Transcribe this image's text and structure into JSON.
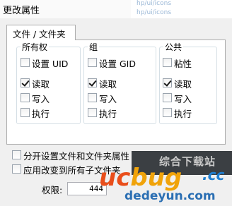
{
  "window": {
    "title": "更改属性"
  },
  "background_ghost": [
    "hp/ui/icons",
    "hp/ui/icons"
  ],
  "tab": {
    "label": "文件 / 文件夹"
  },
  "groups": [
    {
      "title": "所有权",
      "special": {
        "label": "设置 UID",
        "checked": false
      },
      "perms": [
        {
          "label": "读取",
          "checked": true
        },
        {
          "label": "写入",
          "checked": false
        },
        {
          "label": "执行",
          "checked": false
        }
      ]
    },
    {
      "title": "组",
      "special": {
        "label": "设置 GID",
        "checked": false
      },
      "perms": [
        {
          "label": "读取",
          "checked": true
        },
        {
          "label": "写入",
          "checked": false
        },
        {
          "label": "执行",
          "checked": false
        }
      ]
    },
    {
      "title": "公共",
      "special": {
        "label": "粘性",
        "checked": false
      },
      "perms": [
        {
          "label": "读取",
          "checked": true
        },
        {
          "label": "写入",
          "checked": false
        },
        {
          "label": "执行",
          "checked": false
        }
      ]
    }
  ],
  "options": [
    {
      "label": "分开设置文件和文件夹属性",
      "checked": false
    },
    {
      "label": "应用改变到所有子文件夹",
      "checked": false
    }
  ],
  "permission": {
    "label": "权限:",
    "value": "444"
  },
  "watermark": {
    "site_text": "综合下载站",
    "logo_u": "uc",
    "logo_b": "bug",
    "logo_cc": ".cc",
    "domain": "dedeyun.com"
  }
}
